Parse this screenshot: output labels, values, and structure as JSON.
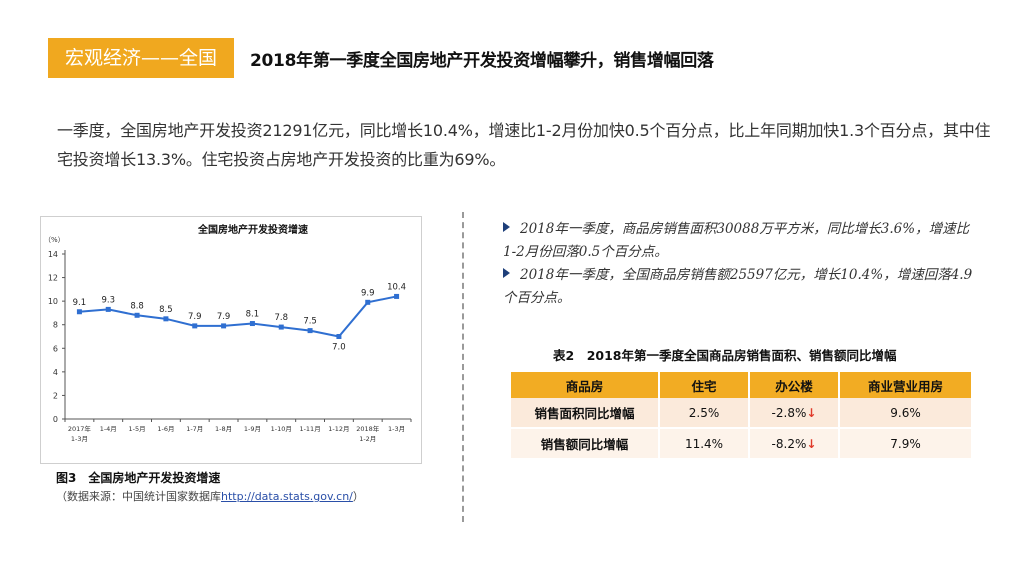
{
  "section_tag": "宏观经济——全国",
  "headline": "2018年第一季度全国房地产开发投资增幅攀升，销售增幅回落",
  "intro": "一季度，全国房地产开发投资21291亿元，同比增长10.4%，增速比1-2月份加快0.5个百分点，比上年同期加快1.3个百分点，其中住宅投资增长13.3%。住宅投资占房地产开发投资的比重为69%。",
  "figure": {
    "caption": "图3　全国房地产开发投资增速",
    "source_prefix": "（数据来源：中国统计国家数据库",
    "source_link": "http://data.stats.gov.cn/",
    "source_suffix": "）"
  },
  "chart_data": {
    "type": "line",
    "title": "全国房地产开发投资增速",
    "ylabel": "（%）",
    "ylim": [
      0,
      14
    ],
    "yticks": [
      0,
      2,
      4,
      6,
      8,
      10,
      12,
      14
    ],
    "grid": false,
    "categories": [
      [
        "2017年",
        "1-3月"
      ],
      [
        "1-4月"
      ],
      [
        "1-5月"
      ],
      [
        "1-6月"
      ],
      [
        "1-7月"
      ],
      [
        "1-8月"
      ],
      [
        "1-9月"
      ],
      [
        "1-10月"
      ],
      [
        "1-11月"
      ],
      [
        "1-12月"
      ],
      [
        "2018年",
        "1-2月"
      ],
      [
        "1-3月"
      ]
    ],
    "series": [
      {
        "name": "",
        "color": "#2f6fd1",
        "values": [
          9.1,
          9.3,
          8.8,
          8.5,
          7.9,
          7.9,
          8.1,
          7.8,
          7.5,
          7.0,
          9.9,
          10.4
        ],
        "labels": [
          "9.1",
          "9.3",
          "8.8",
          "8.5",
          "7.9",
          "7.9",
          "8.1",
          "7.8",
          "7.5",
          "7.0",
          "9.9",
          "10.4"
        ]
      }
    ]
  },
  "bullets": [
    "2018年一季度，商品房销售面积30088万平方米，同比增长3.6%，增速比1-2月份回落0.5个百分点。",
    "2018年一季度，全国商品房销售额25597亿元，增长10.4%，增速回落4.9个百分点。"
  ],
  "table": {
    "title": "表2　2018年第一季度全国商品房销售面积、销售额同比增幅",
    "headers": [
      "商品房",
      "住宅",
      "办公楼",
      "商业营业用房"
    ],
    "rows": [
      [
        "销售面积同比增幅",
        "2.5%",
        "-2.8%",
        "9.6%"
      ],
      [
        "销售额同比增幅",
        "11.4%",
        "-8.2%",
        "7.9%"
      ]
    ],
    "down_arrow": "↓"
  },
  "colors": {
    "accent": "#f0a81f",
    "table_header": "#f2ac23",
    "row1": "#fbeadb",
    "row2": "#fdf3ea",
    "line": "#2f6fd1",
    "down": "#e03a2a"
  }
}
